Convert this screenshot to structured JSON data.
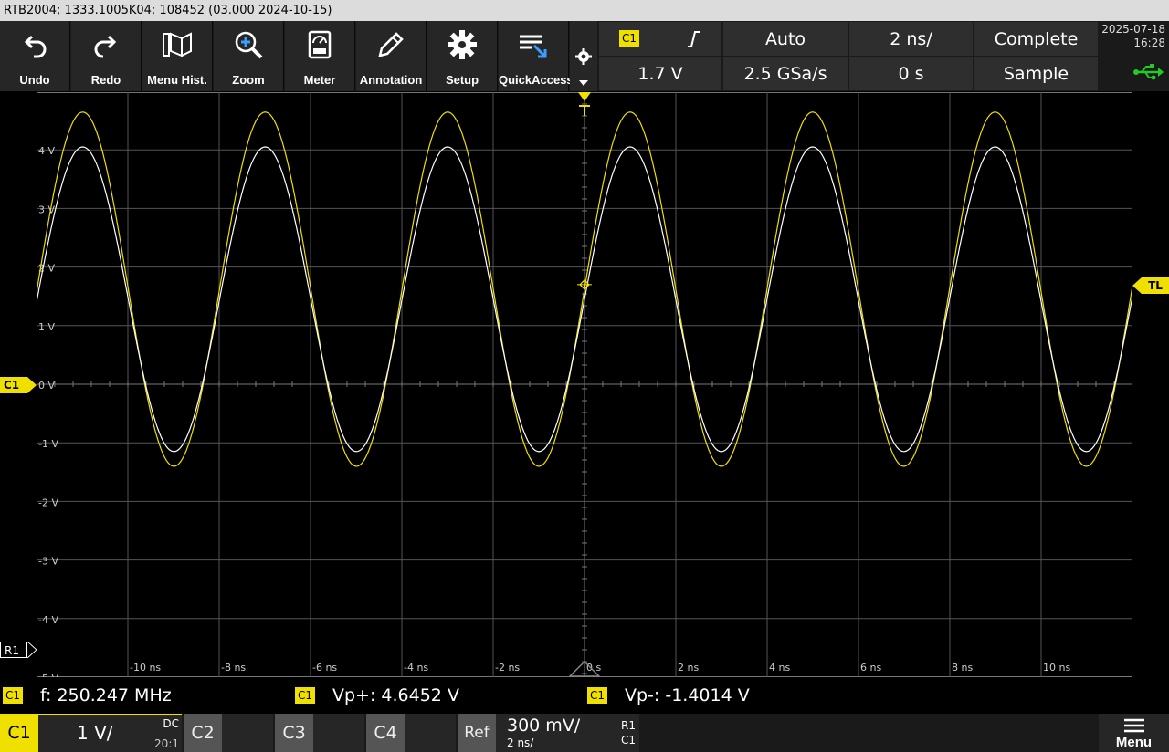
{
  "title": "RTB2004; 1333.1005K04; 108452 (03.000 2024-10-15)",
  "toolbar": [
    {
      "id": "undo",
      "label": "Undo",
      "icon": "undo-icon"
    },
    {
      "id": "redo",
      "label": "Redo",
      "icon": "redo-icon"
    },
    {
      "id": "menu-hist",
      "label": "Menu Hist.",
      "icon": "menu-history-icon"
    },
    {
      "id": "zoom",
      "label": "Zoom",
      "icon": "zoom-icon"
    },
    {
      "id": "meter",
      "label": "Meter",
      "icon": "meter-icon"
    },
    {
      "id": "annotation",
      "label": "Annotation",
      "icon": "pencil-icon"
    },
    {
      "id": "setup",
      "label": "Setup",
      "icon": "gear-icon"
    },
    {
      "id": "quickaccess",
      "label": "QuickAccess",
      "icon": "quick-access-icon"
    }
  ],
  "trigger": {
    "source": "C1",
    "slope_icon": "rising-edge-icon",
    "mode": "Auto",
    "level": "1.7 V",
    "sample_rate": "2.5 GSa/s",
    "timebase": "2 ns/",
    "position": "0 s",
    "acq_status": "Complete",
    "acq_mode": "Sample"
  },
  "datetime": {
    "date": "2025-07-18",
    "time": "16:28"
  },
  "grid": {
    "y_labels": [
      "4 V",
      "3 V",
      "2 V",
      "1 V",
      "0 V",
      "-1 V",
      "-2 V",
      "-3 V",
      "-4 V",
      "-5 V"
    ],
    "x_labels": [
      "-10 ns",
      "-8 ns",
      "-6 ns",
      "-4 ns",
      "-2 ns",
      "0 s",
      "2 ns",
      "4 ns",
      "6 ns",
      "8 ns",
      "10 ns"
    ],
    "markers": {
      "channel": "C1",
      "reference": "R1",
      "trigger_level": "TL"
    }
  },
  "chart_data": {
    "type": "line",
    "xlabel": "",
    "ylabel": "",
    "x_range_ns": [
      -12,
      12
    ],
    "ylim": [
      -5,
      5
    ],
    "series": [
      {
        "name": "C1",
        "color": "#f0e000",
        "frequency_mhz": 250.247,
        "max_v": 4.6452,
        "min_v": -1.4014
      },
      {
        "name": "R1",
        "color": "#ffffff",
        "frequency_mhz": 250.247,
        "max_v": 4.05,
        "min_v": -1.15
      }
    ]
  },
  "measurements": [
    {
      "channel": "C1",
      "text": "f: 250.247 MHz"
    },
    {
      "channel": "C1",
      "text": "Vp+: 4.6452 V"
    },
    {
      "channel": "C1",
      "text": "Vp-: -1.4014 V"
    }
  ],
  "channels": {
    "c1": {
      "label": "C1",
      "scale": "1 V/",
      "coupling": "DC",
      "probe": "20:1"
    },
    "c2": {
      "label": "C2"
    },
    "c3": {
      "label": "C3"
    },
    "c4": {
      "label": "C4"
    },
    "ref": {
      "label": "Ref",
      "scale": "300 mV/",
      "time": "2 ns/",
      "id": "R1",
      "source": "C1"
    }
  },
  "menu_label": "Menu",
  "colors": {
    "c1": "#f0e000",
    "ref": "#ffffff",
    "usb": "#22cc22"
  }
}
